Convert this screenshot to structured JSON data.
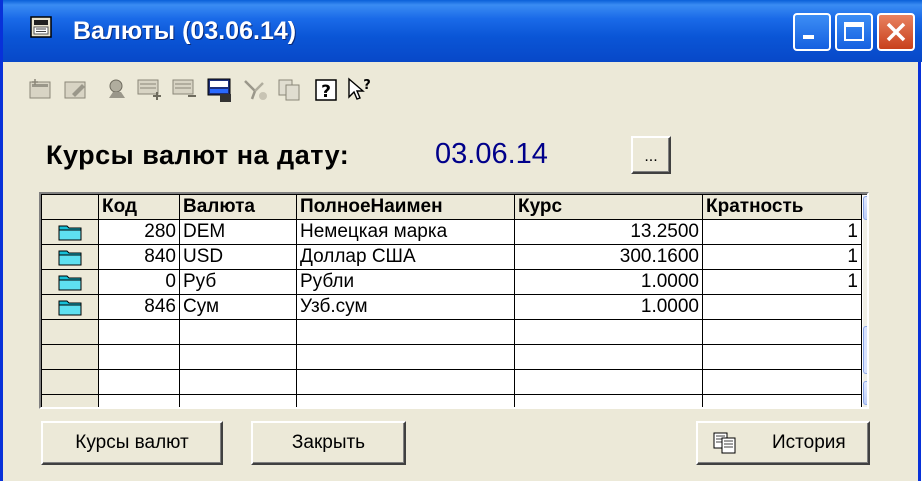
{
  "window": {
    "title": "Валюты (03.06.14)"
  },
  "header": {
    "label": "Курсы валют на дату:",
    "date": "03.06.14",
    "date_button": "..."
  },
  "toolbar": {
    "icons": [
      "new-record-icon",
      "edit-record-icon",
      "find-icon",
      "add-row-icon",
      "delete-row-icon",
      "save-icon",
      "filter-icon",
      "copy-icon",
      "help-icon",
      "context-help-icon"
    ]
  },
  "table": {
    "columns": [
      "",
      "Код",
      "Валюта",
      "ПолноеНаимен",
      "Курс",
      "Кратность"
    ],
    "rows": [
      {
        "code": "280",
        "currency": "DEM",
        "full_name": "Немецкая марка",
        "rate": "13.2500",
        "multiplicity": "1"
      },
      {
        "code": "840",
        "currency": "USD",
        "full_name": "Доллар США",
        "rate": "300.1600",
        "multiplicity": "1"
      },
      {
        "code": "0",
        "currency": "Руб",
        "full_name": "Рубли",
        "rate": "1.0000",
        "multiplicity": "1"
      },
      {
        "code": "846",
        "currency": "Сум",
        "full_name": "Узб.сум",
        "rate": "1.0000",
        "multiplicity": ""
      }
    ]
  },
  "buttons": {
    "rates": "Курсы валют",
    "close": "Закрыть",
    "history": "История"
  },
  "colors": {
    "title_bar": "#0a55d6",
    "date_text": "#00008a",
    "window_bg": "#ece9d8"
  }
}
